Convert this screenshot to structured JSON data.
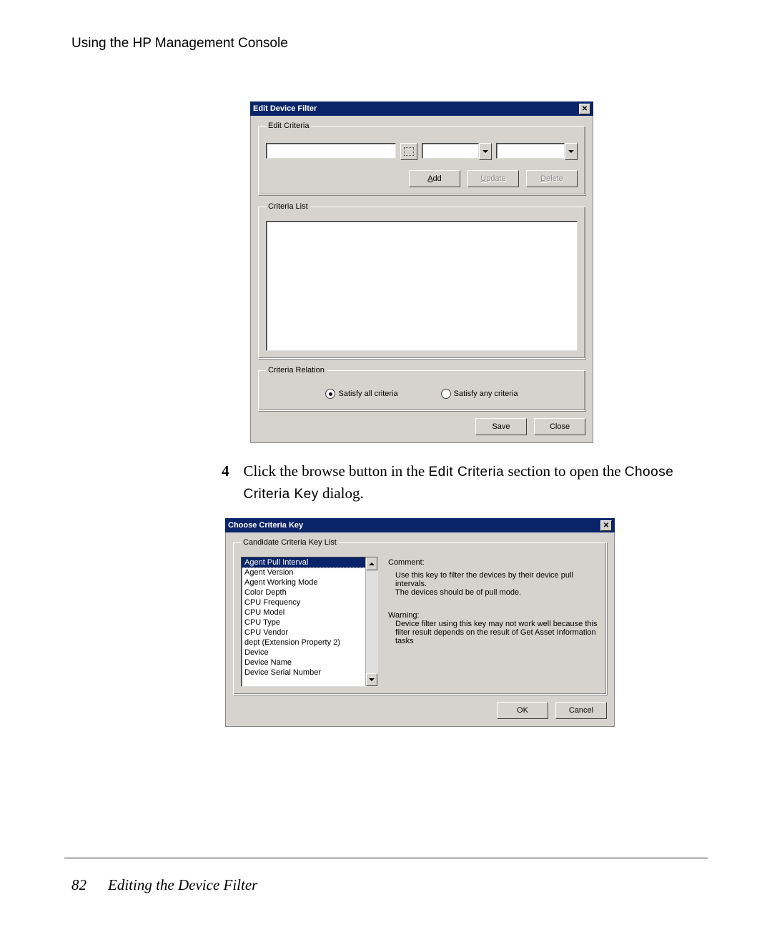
{
  "header": {
    "title": "Using the HP Management Console"
  },
  "dialog1": {
    "title": "Edit Device Filter",
    "edit_criteria_legend": "Edit Criteria",
    "criteria_list_legend": "Criteria List",
    "criteria_relation_legend": "Criteria Relation",
    "add_label": "Add",
    "update_label": "Update",
    "delete_label": "Delete",
    "radio_all": "Satisfy all criteria",
    "radio_any": "Satisfy any criteria",
    "save_label": "Save",
    "close_label": "Close"
  },
  "instruction": {
    "num": "4",
    "text_pre": "Click the browse button in the ",
    "label1": "Edit Criteria",
    "text_mid": " section to open the ",
    "label2": "Choose Criteria Key",
    "text_post": " dialog."
  },
  "dialog2": {
    "title": "Choose Criteria Key",
    "candidate_legend": "Candidate Criteria Key List",
    "items": [
      "Agent Pull Interval",
      "Agent Version",
      "Agent Working Mode",
      "Color Depth",
      "CPU Frequency",
      "CPU Model",
      "CPU Type",
      "CPU Vendor",
      "dept  (Extension Property 2)",
      "Device",
      "Device Name",
      "Device Serial Number"
    ],
    "selected_index": 0,
    "comment_label": "Comment:",
    "comment_line1": "Use this key to filter the devices by their device pull intervals.",
    "comment_line2": "The devices should be of pull mode.",
    "warning_label": "Warning:",
    "warning_text": "Device filter using this key may not work well because this filter result depends on the result of Get Asset Information tasks",
    "ok_label": "OK",
    "cancel_label": "Cancel"
  },
  "footer": {
    "page": "82",
    "section": "Editing the Device Filter"
  }
}
